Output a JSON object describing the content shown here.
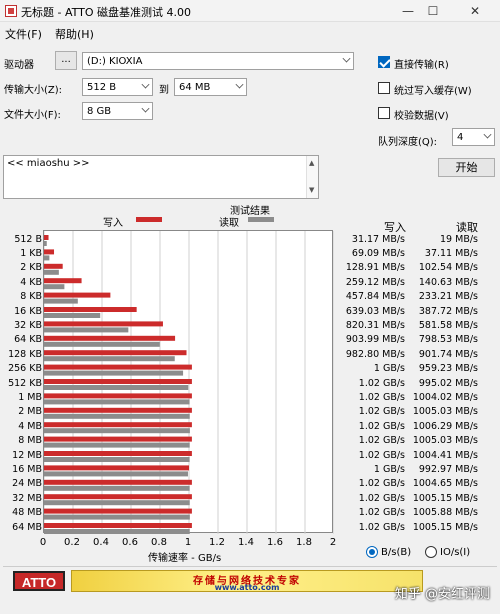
{
  "window": {
    "title": "无标题 - ATTO 磁盘基准测试 4.00",
    "minimize": "—",
    "maximize": "☐",
    "close": "✕"
  },
  "menu": [
    "文件(F)",
    "帮助(H)"
  ],
  "controls": {
    "drive_label": "驱动器",
    "browse_label": "...",
    "drive_value": "(D:) KIOXIA",
    "transfer_label": "传输大小(Z):",
    "transfer_from": "512 B",
    "to_label": "到",
    "transfer_to": "64 MB",
    "file_size_label": "文件大小(F):",
    "file_size": "8 GB",
    "direct_io": "直接传输(R)",
    "bypass_write_cache": "统过写入缓存(W)",
    "verify_data": "校验数据(V)",
    "queue_depth_label": "队列深度(Q):",
    "queue_depth": "4",
    "start_button": "开始",
    "description": "<< miaoshu >>"
  },
  "checkboxes": {
    "direct_io": true,
    "bypass_write_cache": false,
    "verify_data": false
  },
  "results": {
    "header": "测试结果",
    "write_legend": "写入",
    "read_legend": "读取",
    "write_col": "写入",
    "read_col": "读取",
    "x_axis_title": "传输速率 - GB/s",
    "unit_bytes": "B/s(B)",
    "unit_io": "IO/s(I)",
    "selected_unit": "bytes"
  },
  "chart_data": {
    "type": "bar",
    "orientation": "horizontal",
    "xlabel": "传输速率 - GB/s",
    "xlim": [
      0,
      2
    ],
    "xticks": [
      "0",
      "0.2",
      "0.4",
      "0.6",
      "0.8",
      "1",
      "1.2",
      "1.4",
      "1.6",
      "1.8",
      "2"
    ],
    "categories": [
      "512 B",
      "1 KB",
      "2 KB",
      "4 KB",
      "8 KB",
      "16 KB",
      "32 KB",
      "64 KB",
      "128 KB",
      "256 KB",
      "512 KB",
      "1 MB",
      "2 MB",
      "4 MB",
      "8 MB",
      "12 MB",
      "16 MB",
      "24 MB",
      "32 MB",
      "48 MB",
      "64 MB"
    ],
    "series": [
      {
        "name": "写入",
        "color": "#cc2b2b",
        "values": [
          0.0312,
          0.0691,
          0.1289,
          0.2591,
          0.4578,
          0.639,
          0.8203,
          0.904,
          0.9828,
          1.02,
          1.02,
          1.02,
          1.02,
          1.02,
          1.02,
          1.02,
          1.0,
          1.02,
          1.02,
          1.02,
          1.02
        ],
        "labels": [
          "31.17 MB/s",
          "69.09 MB/s",
          "128.91 MB/s",
          "259.12 MB/s",
          "457.84 MB/s",
          "639.03 MB/s",
          "820.31 MB/s",
          "903.99 MB/s",
          "982.80 MB/s",
          "1 GB/s",
          "1.02 GB/s",
          "1.02 GB/s",
          "1.02 GB/s",
          "1.02 GB/s",
          "1.02 GB/s",
          "1.02 GB/s",
          "1 GB/s",
          "1.02 GB/s",
          "1.02 GB/s",
          "1.02 GB/s",
          "1.02 GB/s"
        ]
      },
      {
        "name": "读取",
        "color": "#8c8c8c",
        "values": [
          0.019,
          0.0371,
          0.1025,
          0.1406,
          0.2332,
          0.3877,
          0.5816,
          0.7985,
          0.9017,
          0.9592,
          0.995,
          1.004,
          1.0052,
          1.0063,
          1.005,
          1.0044,
          0.993,
          1.0047,
          1.0052,
          1.0059,
          1.0052
        ],
        "labels": [
          "19 MB/s",
          "37.11 MB/s",
          "102.54 MB/s",
          "140.63 MB/s",
          "233.21 MB/s",
          "387.72 MB/s",
          "581.58 MB/s",
          "798.53 MB/s",
          "901.74 MB/s",
          "959.23 MB/s",
          "995.02 MB/s",
          "1004.02 MB/s",
          "1005.03 MB/s",
          "1006.29 MB/s",
          "1005.03 MB/s",
          "1004.41 MB/s",
          "992.97 MB/s",
          "1004.65 MB/s",
          "1005.15 MB/s",
          "1005.88 MB/s",
          "1005.15 MB/s"
        ]
      }
    ]
  },
  "footer": {
    "logo": "ATTO",
    "banner_text": "存储与网络技术专家",
    "banner_url": "www.atto.com"
  },
  "watermark": "知乎 @安红评测"
}
